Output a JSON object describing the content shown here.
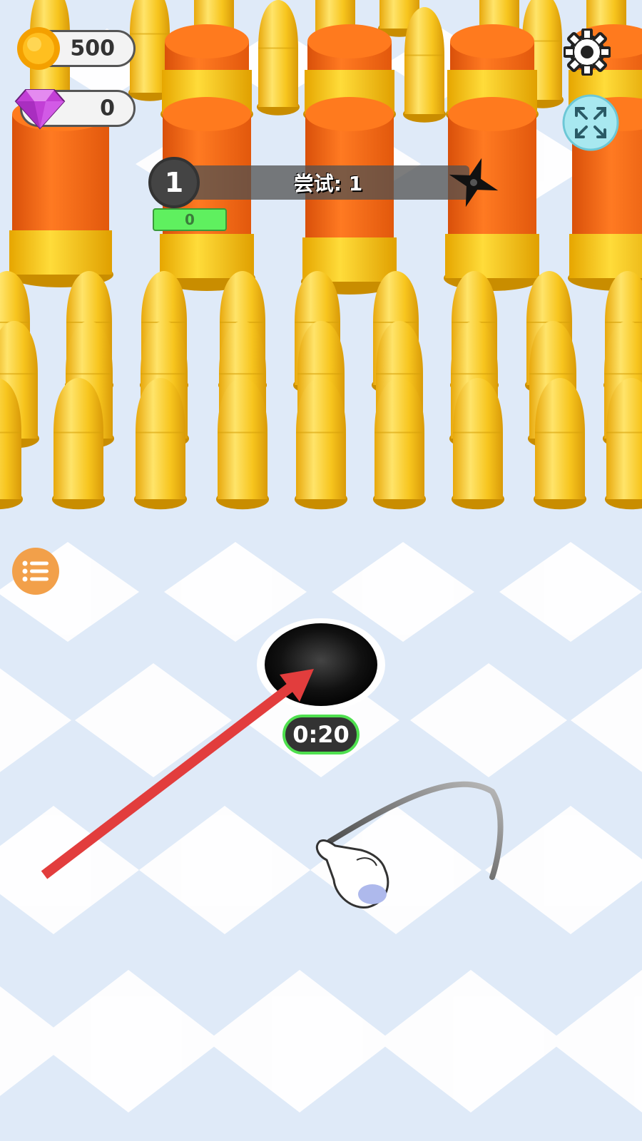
{
  "hud": {
    "coins": "500",
    "gems": "0",
    "icons": {
      "coin": "coin-icon",
      "gem": "gem-icon",
      "settings": "gear-icon",
      "fullscreen": "expand-icon",
      "menu": "list-icon",
      "goal": "shuriken-icon"
    }
  },
  "level": {
    "number": "1",
    "attempt_text": "尝试: 1",
    "progress_value": "0"
  },
  "hole": {
    "timer": "0:20"
  },
  "tutorial": {
    "arrow_color": "#e23d3d",
    "hand_icon": "pointing-hand-icon"
  },
  "colors": {
    "bullet": "#f7c51e",
    "shell": "#f26a12",
    "timer_border": "#4fe04f",
    "menu_button": "#f2a04a",
    "floor": "#dfeaf8"
  }
}
